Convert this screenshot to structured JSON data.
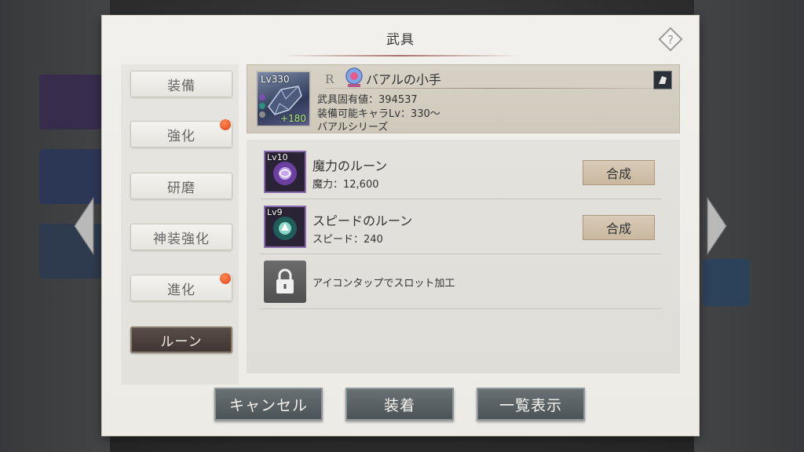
{
  "dialog": {
    "title": "武具"
  },
  "sidebar": {
    "items": [
      {
        "label": "装備",
        "badge": false
      },
      {
        "label": "強化",
        "badge": true
      },
      {
        "label": "研磨",
        "badge": false
      },
      {
        "label": "神装強化",
        "badge": false
      },
      {
        "label": "進化",
        "badge": true
      },
      {
        "label": "ルーン",
        "badge": false,
        "active": true
      }
    ]
  },
  "item": {
    "level": "Lv330",
    "plus": "+180",
    "rarity": "R",
    "name": "バアルの小手",
    "value_line": "武具固有値：394537",
    "equip_line": "装備可能キャラLv：330～",
    "series_line": "バアルシリーズ"
  },
  "runes": [
    {
      "level": "Lv10",
      "name": "魔力のルーン",
      "stat": "魔力：12,600",
      "button": "合成",
      "color": "#7a4fb0"
    },
    {
      "level": "Lv9",
      "name": "スピードのルーン",
      "stat": "スピード：240",
      "button": "合成",
      "color": "#2f8f7f"
    }
  ],
  "locked_slot": {
    "text": "アイコンタップでスロット加工",
    "icon": "lock-icon"
  },
  "footer": {
    "cancel": "キャンセル",
    "equip": "装着",
    "list": "一覧表示"
  },
  "colors": {
    "badge": "#e0401a",
    "accent_line": "#965046",
    "active_tab": "#4a3f3b"
  }
}
